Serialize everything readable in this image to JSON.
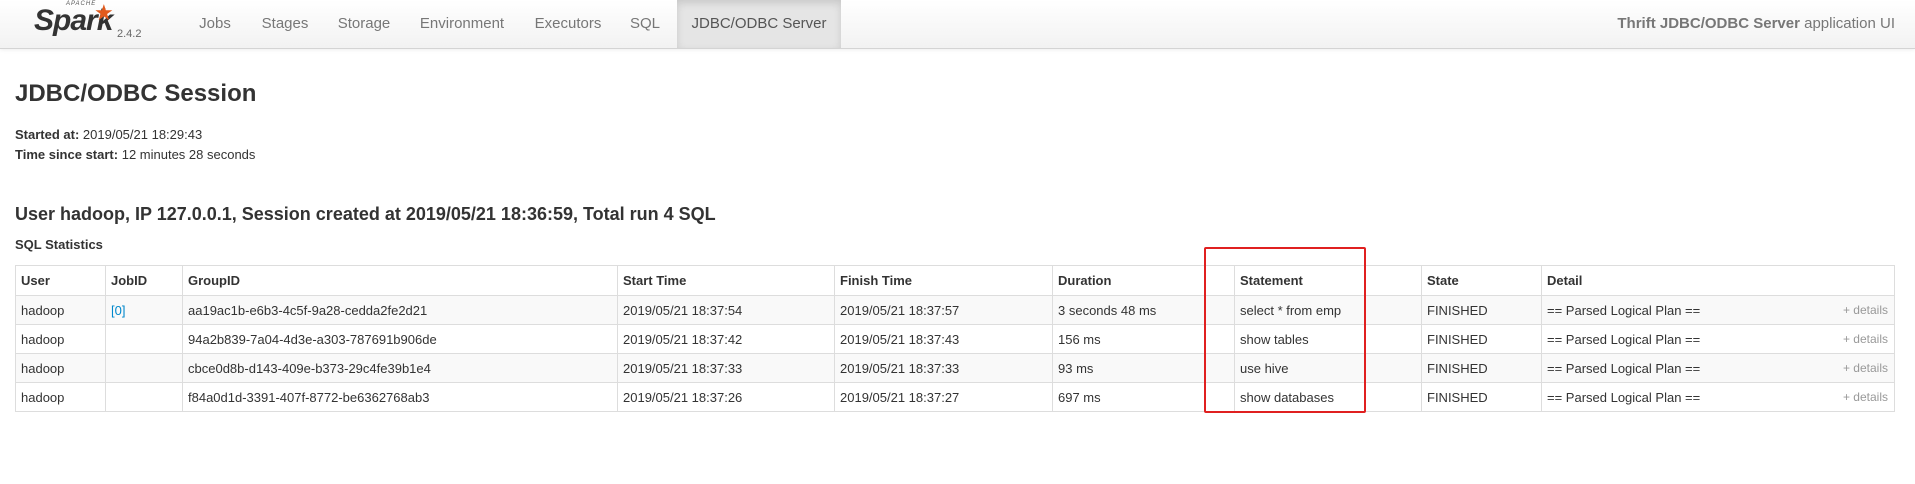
{
  "nav": {
    "brand_apache": "APACHE",
    "brand_name": "Spark",
    "version": "2.4.2",
    "tabs": [
      {
        "label": "Jobs"
      },
      {
        "label": "Stages"
      },
      {
        "label": "Storage"
      },
      {
        "label": "Environment"
      },
      {
        "label": "Executors"
      },
      {
        "label": "SQL"
      },
      {
        "label": "JDBC/ODBC Server",
        "active": true
      }
    ],
    "app_name": "Thrift JDBC/ODBC Server",
    "app_suffix": "application UI"
  },
  "page": {
    "title": "JDBC/ODBC Session",
    "started_label": "Started at:",
    "started_value": "2019/05/21 18:29:43",
    "elapsed_label": "Time since start:",
    "elapsed_value": "12 minutes 28 seconds",
    "session_heading": "User hadoop, IP 127.0.0.1, Session created at 2019/05/21 18:36:59, Total run 4 SQL",
    "stats_heading": "SQL Statistics"
  },
  "table": {
    "headers": [
      "User",
      "JobID",
      "GroupID",
      "Start Time",
      "Finish Time",
      "Duration",
      "Statement",
      "State",
      "Detail"
    ],
    "rows": [
      {
        "user": "hadoop",
        "jobid": "[0]",
        "groupid": "aa19ac1b-e6b3-4c5f-9a28-cedda2fe2d21",
        "start": "2019/05/21 18:37:54",
        "finish": "2019/05/21 18:37:57",
        "duration": "3 seconds 48 ms",
        "statement": "select * from emp",
        "state": "FINISHED",
        "detail": "== Parsed Logical Plan ==",
        "details_link": "+ details"
      },
      {
        "user": "hadoop",
        "jobid": "",
        "groupid": "94a2b839-7a04-4d3e-a303-787691b906de",
        "start": "2019/05/21 18:37:42",
        "finish": "2019/05/21 18:37:43",
        "duration": "156 ms",
        "statement": "show tables",
        "state": "FINISHED",
        "detail": "== Parsed Logical Plan ==",
        "details_link": "+ details"
      },
      {
        "user": "hadoop",
        "jobid": "",
        "groupid": "cbce0d8b-d143-409e-b373-29c4fe39b1e4",
        "start": "2019/05/21 18:37:33",
        "finish": "2019/05/21 18:37:33",
        "duration": "93 ms",
        "statement": "use hive",
        "state": "FINISHED",
        "detail": "== Parsed Logical Plan ==",
        "details_link": "+ details"
      },
      {
        "user": "hadoop",
        "jobid": "",
        "groupid": "f84a0d1d-3391-407f-8772-be6362768ab3",
        "start": "2019/05/21 18:37:26",
        "finish": "2019/05/21 18:37:27",
        "duration": "697 ms",
        "statement": "show databases",
        "state": "FINISHED",
        "detail": "== Parsed Logical Plan ==",
        "details_link": "+ details"
      }
    ]
  },
  "colors": {
    "link": "#0088cc",
    "highlight_box": "#e02020",
    "spark_orange": "#e25a1c"
  }
}
